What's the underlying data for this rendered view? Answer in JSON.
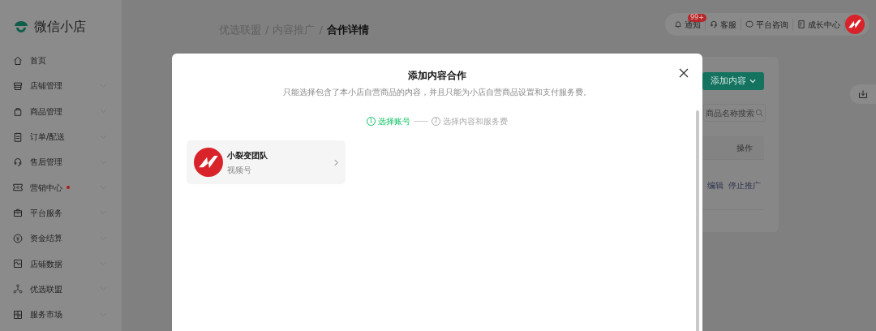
{
  "sidebar": {
    "logo": "微信小店",
    "items": [
      {
        "label": "首页",
        "kind": "home",
        "expandable": false,
        "dot": false
      },
      {
        "label": "店铺管理",
        "kind": "store",
        "expandable": true,
        "dot": false
      },
      {
        "label": "商品管理",
        "kind": "bag",
        "expandable": true,
        "dot": false
      },
      {
        "label": "订单/配送",
        "kind": "clipboard",
        "expandable": true,
        "dot": false
      },
      {
        "label": "售后管理",
        "kind": "headset",
        "expandable": true,
        "dot": false
      },
      {
        "label": "营销中心",
        "kind": "ticket",
        "expandable": true,
        "dot": true
      },
      {
        "label": "平台服务",
        "kind": "briefcase",
        "expandable": true,
        "dot": false
      },
      {
        "label": "资金结算",
        "kind": "coin",
        "expandable": true,
        "dot": false
      },
      {
        "label": "店铺数据",
        "kind": "chart",
        "expandable": true,
        "dot": false
      },
      {
        "label": "优选联盟",
        "kind": "network",
        "expandable": true,
        "dot": false
      },
      {
        "label": "服务市场",
        "kind": "grid",
        "expandable": true,
        "dot": false
      }
    ]
  },
  "breadcrumb": {
    "separator": "/",
    "items": [
      {
        "label": "优选联盟",
        "current": false
      },
      {
        "label": "内容推广",
        "current": false
      },
      {
        "label": "合作详情",
        "current": true
      }
    ]
  },
  "topbar": {
    "items": [
      {
        "label": "通知",
        "kind": "bell",
        "badge": "99+"
      },
      {
        "label": "客服",
        "kind": "headset"
      },
      {
        "label": "平台咨询",
        "kind": "chat"
      },
      {
        "label": "成长中心",
        "kind": "doc"
      }
    ]
  },
  "card": {
    "add_button": "添加内容",
    "search": {
      "placeholder": "商品名称搜索"
    },
    "table": {
      "columns": [
        "操作"
      ],
      "rows": [
        {
          "actions": [
            "编辑",
            "停止推广"
          ]
        }
      ]
    }
  },
  "modal": {
    "title": "添加内容合作",
    "subtitle": "只能选择包含了本小店自营商品的内容，并且只能为小店自营商品设置和支付服务费。",
    "steps": [
      {
        "number": "1",
        "label": "选择账号",
        "selected": true
      },
      {
        "number": "2",
        "label": "选择内容和服务费",
        "selected": false
      }
    ],
    "accounts": [
      {
        "name": "小裂变团队",
        "type": "视频号"
      }
    ]
  }
}
